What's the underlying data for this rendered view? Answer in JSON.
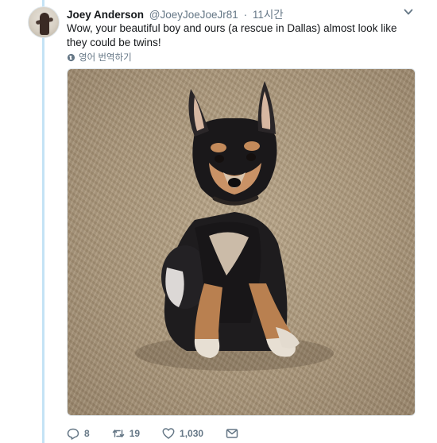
{
  "tweet": {
    "author_name": "Joey Anderson",
    "handle": "@JoeyJoeJoeJr81",
    "separator": "·",
    "time": "11시간",
    "text": "Wow, your beautiful boy and ours (a rescue in Dallas) almost look like they could be twins!",
    "translate_label": "영어 번역하기"
  },
  "actions": {
    "reply_count": "8",
    "retweet_count": "19",
    "like_count": "1,030"
  },
  "icons": {
    "menu": "chevron-down-icon",
    "translate": "globe-icon",
    "reply": "reply-icon",
    "retweet": "retweet-icon",
    "like": "heart-icon",
    "dm": "envelope-icon"
  },
  "colors": {
    "thread_line": "#c4e3f5",
    "secondary_text": "#657786",
    "primary_text": "#14171a"
  }
}
